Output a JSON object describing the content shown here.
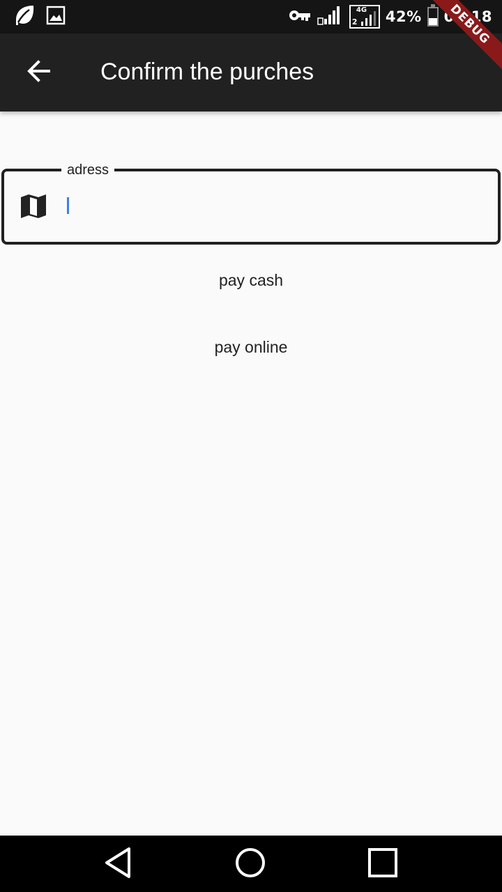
{
  "status_bar": {
    "battery": "42%",
    "time": "09:18",
    "network": "4G",
    "sim": "2"
  },
  "debug_banner": "DEBUG",
  "app_bar": {
    "title": "Confirm the purches"
  },
  "address_field": {
    "label": "adress",
    "value": "",
    "icon": "map-icon"
  },
  "buttons": {
    "pay_cash": "pay cash",
    "pay_online": "pay online"
  },
  "colors": {
    "app_bar": "#212121",
    "status_bar": "#151515",
    "background": "#fafafa",
    "cursor": "#3f7fe6",
    "debug_ribbon": "#8a1a1a"
  }
}
